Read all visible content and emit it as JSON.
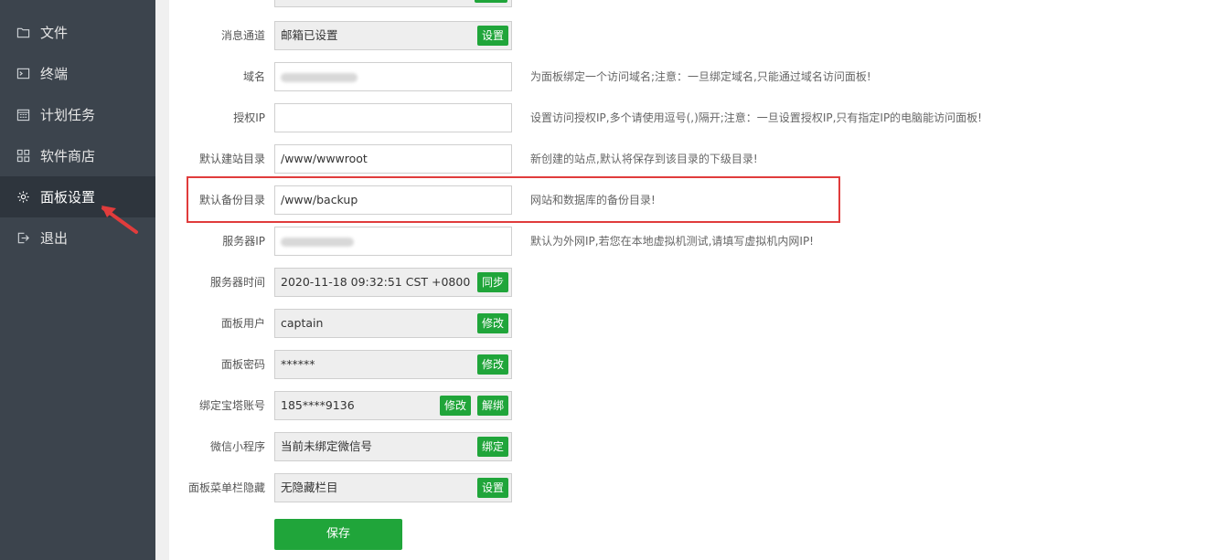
{
  "sidebar": {
    "items": [
      {
        "label": "文件",
        "icon": "folder-icon"
      },
      {
        "label": "终端",
        "icon": "terminal-icon"
      },
      {
        "label": "计划任务",
        "icon": "calendar-icon"
      },
      {
        "label": "软件商店",
        "icon": "grid-icon"
      },
      {
        "label": "面板设置",
        "icon": "gear-icon"
      },
      {
        "label": "退出",
        "icon": "logout-icon"
      }
    ]
  },
  "settings": {
    "message_channel": {
      "label": "消息通道",
      "value": "邮箱已设置",
      "button": "设置"
    },
    "domain": {
      "label": "域名",
      "hint": "为面板绑定一个访问域名;注意：一旦绑定域名,只能通过域名访问面板!"
    },
    "authorized_ip": {
      "label": "授权IP",
      "value": "",
      "hint": "设置访问授权IP,多个请使用逗号(,)隔开;注意：一旦设置授权IP,只有指定IP的电脑能访问面板!"
    },
    "default_site_dir": {
      "label": "默认建站目录",
      "value": "/www/wwwroot",
      "hint": "新创建的站点,默认将保存到该目录的下级目录!"
    },
    "default_backup_dir": {
      "label": "默认备份目录",
      "value": "/www/backup",
      "hint": "网站和数据库的备份目录!"
    },
    "server_ip": {
      "label": "服务器IP",
      "hint": "默认为外网IP,若您在本地虚拟机测试,请填写虚拟机内网IP!"
    },
    "server_time": {
      "label": "服务器时间",
      "value": "2020-11-18 09:32:51 CST +0800",
      "button": "同步"
    },
    "panel_user": {
      "label": "面板用户",
      "value": "captain",
      "button": "修改"
    },
    "panel_password": {
      "label": "面板密码",
      "value": "******",
      "button": "修改"
    },
    "bind_account": {
      "label": "绑定宝塔账号",
      "value": "185****9136",
      "button_edit": "修改",
      "button_unbind": "解绑"
    },
    "wechat_miniapp": {
      "label": "微信小程序",
      "value": "当前未绑定微信号",
      "button": "绑定"
    },
    "menu_hide": {
      "label": "面板菜单栏隐藏",
      "value": "无隐藏栏目",
      "button": "设置"
    }
  },
  "save_label": "保存",
  "colors": {
    "sidebar_bg": "#3c444d",
    "sidebar_active": "#2e353d",
    "accent_green": "#20a53a",
    "highlight_red": "#e03c3c"
  }
}
